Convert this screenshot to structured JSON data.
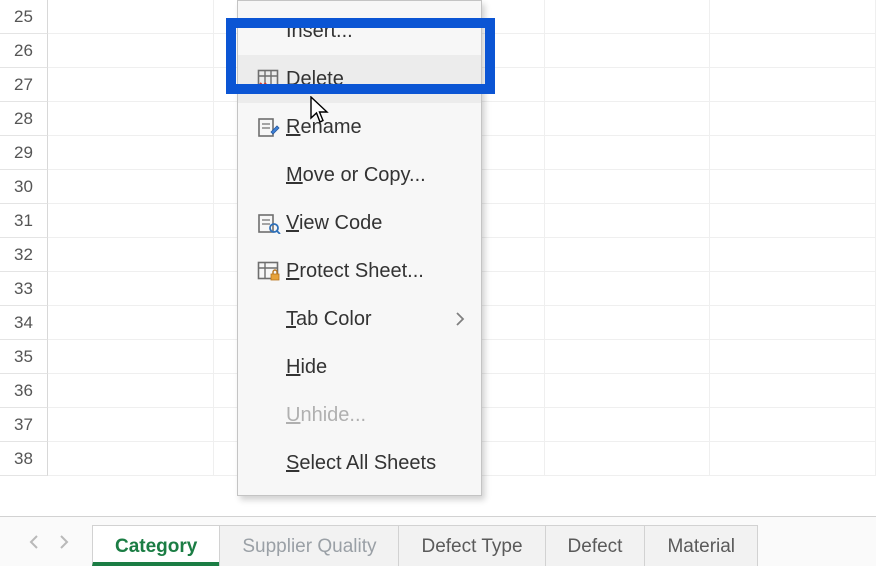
{
  "rows": [
    "25",
    "26",
    "27",
    "28",
    "29",
    "30",
    "31",
    "32",
    "33",
    "34",
    "35",
    "36",
    "37",
    "38"
  ],
  "cols_count": 5,
  "menu": {
    "insert": "Insert...",
    "delete": "Delete",
    "rename": "Rename",
    "move": "Move or Copy...",
    "view_code": "View Code",
    "protect": "Protect Sheet...",
    "tab_color": "Tab Color",
    "hide": "Hide",
    "unhide": "Unhide...",
    "select_all": "Select All Sheets"
  },
  "tabs": {
    "active": "Category",
    "partial": "Supplier Quality",
    "t3": "Defect Type",
    "t4": "Defect",
    "t5": "Material"
  }
}
